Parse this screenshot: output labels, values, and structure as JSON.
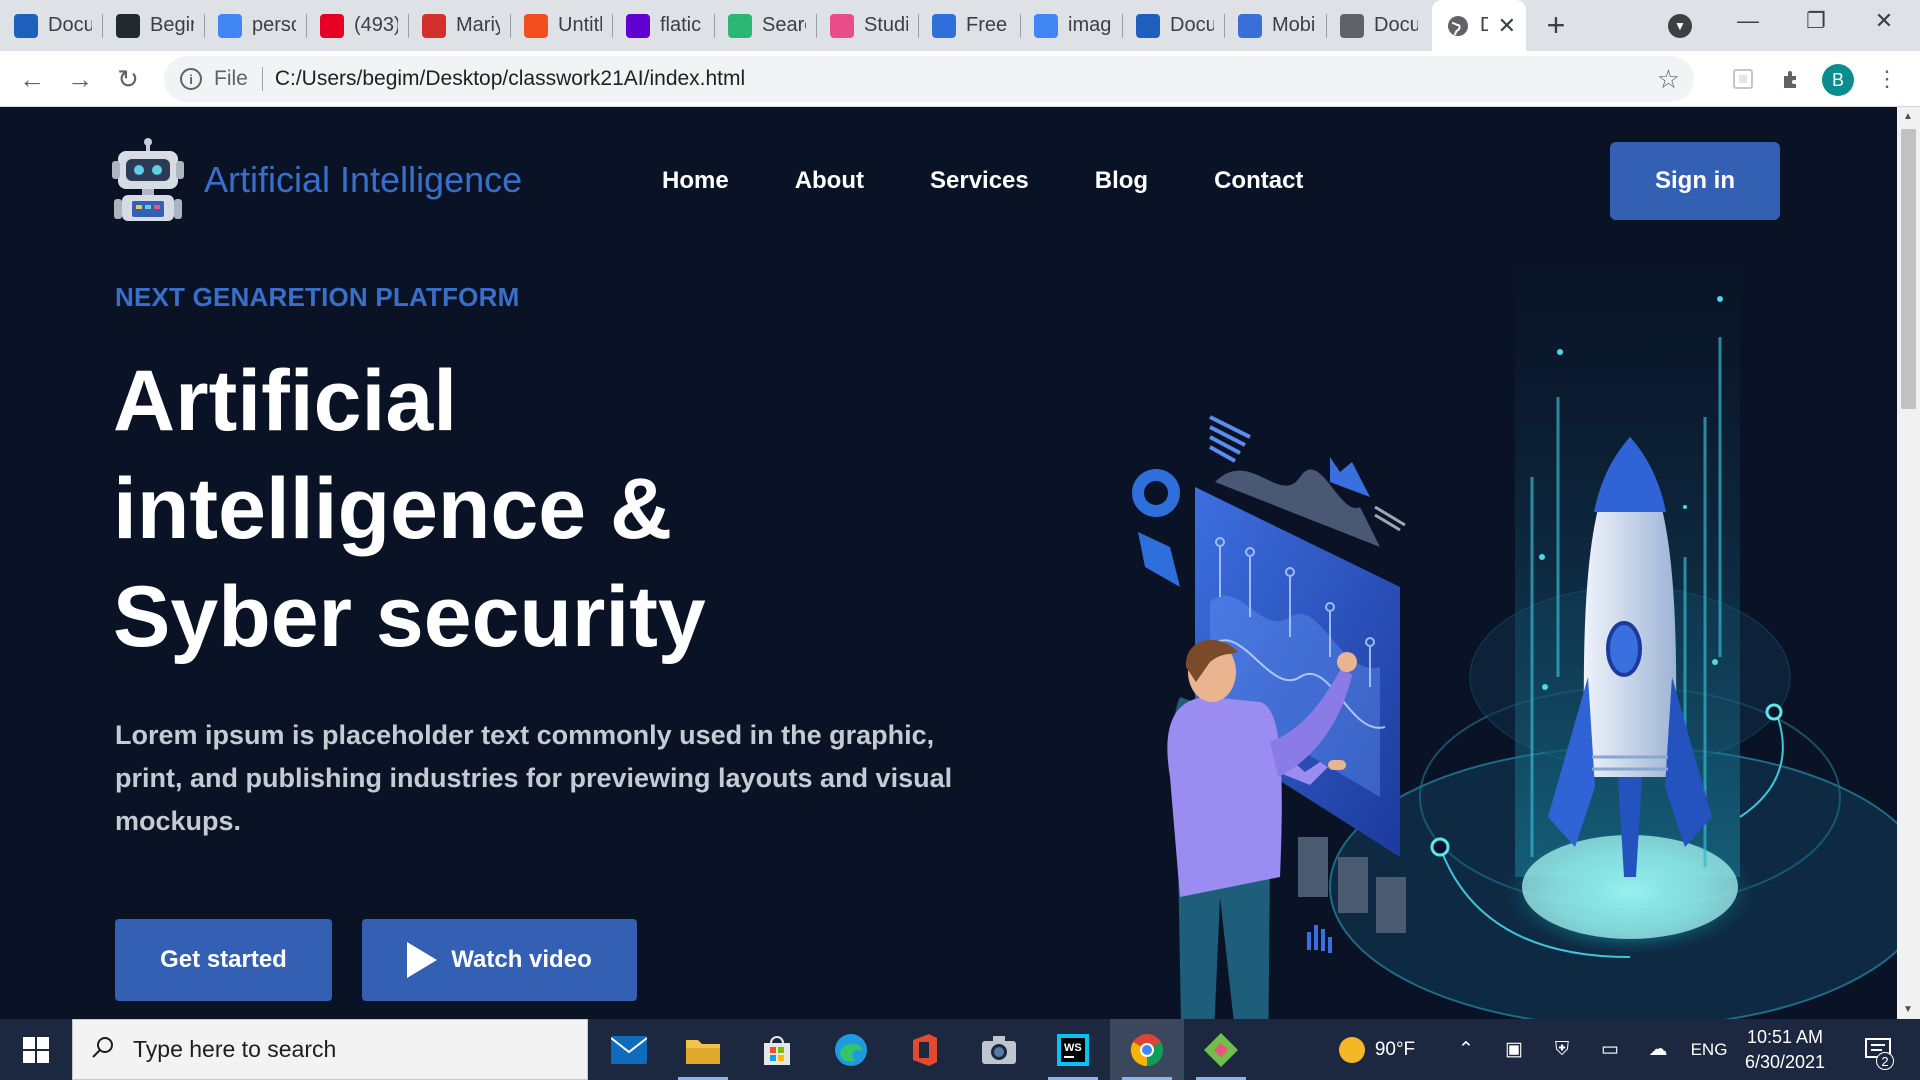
{
  "browser": {
    "tabs": [
      {
        "label": "Docu",
        "icon": "webstorm-icon",
        "color": "#1f5fbf"
      },
      {
        "label": "Begir",
        "icon": "github-icon",
        "color": "#24292e"
      },
      {
        "label": "perso",
        "icon": "google-icon",
        "color": "#4285f4"
      },
      {
        "label": "(493)",
        "icon": "pinterest-icon",
        "color": "#e60023"
      },
      {
        "label": "Mariy",
        "icon": "flag-red-icon",
        "color": "#d32f2f"
      },
      {
        "label": "Untitl",
        "icon": "figma-icon",
        "color": "#f24e1e"
      },
      {
        "label": "flatic",
        "icon": "yahoo-icon",
        "color": "#6001d2"
      },
      {
        "label": "Searc",
        "icon": "vuetify-icon",
        "color": "#2bb673"
      },
      {
        "label": "Studi",
        "icon": "dribbble-icon",
        "color": "#ea4c89"
      },
      {
        "label": "Free ",
        "icon": "reddit-icon",
        "color": "#2f6fdc"
      },
      {
        "label": "imag",
        "icon": "google-icon",
        "color": "#4285f4"
      },
      {
        "label": "Docu",
        "icon": "webstorm-icon",
        "color": "#1f5fbf"
      },
      {
        "label": "Mobi",
        "icon": "flag-blue-icon",
        "color": "#3b6fd8"
      },
      {
        "label": "Docu",
        "icon": "globe-icon",
        "color": "#5f6368"
      }
    ],
    "active_tab": {
      "label": "D",
      "icon": "globe-icon"
    },
    "file_label": "File",
    "url": "C:/Users/begim/Desktop/classwork21AI/index.html",
    "profile_initial": "B"
  },
  "site": {
    "brand": "Artificial Intelligence",
    "nav": [
      "Home",
      "About",
      "Services",
      "Blog",
      "Contact"
    ],
    "signin": "Sign in",
    "eyebrow": "NEXT GENARETION PLATFORM",
    "headline": [
      "Artificial",
      "intelligence &",
      "Syber security"
    ],
    "lead": "Lorem ipsum is placeholder text commonly used in the graphic, print, and publishing industries for previewing layouts and visual mockups.",
    "buttons": {
      "primary": "Get started",
      "video": "Watch video"
    },
    "colors": {
      "accent": "#3460b3",
      "background": "#0a1326",
      "brand_text": "#3a6fc9"
    }
  },
  "taskbar": {
    "search_placeholder": "Type here to search",
    "weather": "90°F",
    "language": "ENG",
    "time": "10:51 AM",
    "date": "6/30/2021",
    "notification_count": "2"
  }
}
